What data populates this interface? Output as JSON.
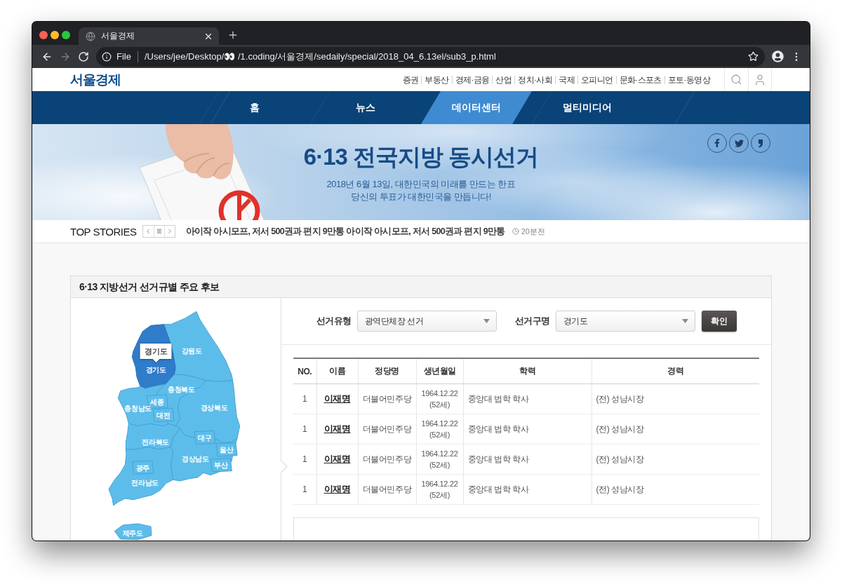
{
  "browser": {
    "tab_title": "서울경제",
    "nav_buttons": [
      {
        "kind": "back",
        "disabled": false
      },
      {
        "kind": "forward",
        "disabled": true
      },
      {
        "kind": "reload",
        "disabled": false
      }
    ],
    "address": {
      "scheme": "File",
      "url": "/Users/jee/Desktop/👀 /1.coding/서울경제/sedaily/special/2018_04_6.13el/sub3_p.html"
    }
  },
  "header": {
    "logo": "서울경제",
    "sections": [
      "증권",
      "부동산",
      "경제·금융",
      "산업",
      "정치·사회",
      "국제",
      "오피니언",
      "문화·스포츠",
      "포토·동영상"
    ]
  },
  "nav": [
    {
      "label": "홈",
      "selected": false
    },
    {
      "label": "뉴스",
      "selected": false
    },
    {
      "label": "데이터센터",
      "selected": true
    },
    {
      "label": "멀티미디어",
      "selected": false
    }
  ],
  "banner": {
    "title": "6·13 전국지방 동시선거",
    "subtitle": [
      "2018년 6월 13일, 대한민국의 미래를 만드는 한표",
      "당신의 투표가 대한민국을 만듭니다!"
    ]
  },
  "top_stories": {
    "heading": "TOP STORIES",
    "headline": "아이작 아시모프, 저서 500권과 편지 9만통 아이작 아시모프, 저서 500권과 편지 9만통",
    "time": "20분전"
  },
  "panel": {
    "title": "6·13 지방선거 선거규별 주요 후보",
    "map": {
      "tooltip": "경기도",
      "regions": [
        {
          "label": "강원도",
          "selected": false
        },
        {
          "label": "경기도",
          "selected": true
        },
        {
          "label": "충청북도",
          "selected": false
        },
        {
          "label": "세종",
          "selected": false
        },
        {
          "label": "충청남도",
          "selected": false
        },
        {
          "label": "대전",
          "selected": false
        },
        {
          "label": "경상북도",
          "selected": false
        },
        {
          "label": "대구",
          "selected": false
        },
        {
          "label": "전라북도",
          "selected": false
        },
        {
          "label": "울산",
          "selected": false
        },
        {
          "label": "경상남도",
          "selected": false
        },
        {
          "label": "부산",
          "selected": false
        },
        {
          "label": "광주",
          "selected": false
        },
        {
          "label": "전라남도",
          "selected": false
        },
        {
          "label": "제주도",
          "selected": false
        }
      ]
    },
    "filters": [
      {
        "label": "선거유형",
        "value": "광역단체장 선거"
      },
      {
        "label": "선거구명",
        "value": "경기도"
      }
    ],
    "confirm_button": "확인",
    "table": {
      "columns": [
        "NO.",
        "이름",
        "정당명",
        "생년월일",
        "학력",
        "경력"
      ],
      "rows": [
        {
          "no": "1",
          "name": "이재명",
          "party": "더불어민주당",
          "birth": "1964.12.22 (52세)",
          "education": "중앙대 법학 학사",
          "career": "(전) 성남시장"
        },
        {
          "no": "1",
          "name": "이재명",
          "party": "더불어민주당",
          "birth": "1964.12.22 (52세)",
          "education": "중앙대 법학 학사",
          "career": "(전) 성남시장"
        },
        {
          "no": "1",
          "name": "이재명",
          "party": "더불어민주당",
          "birth": "1964.12.22 (52세)",
          "education": "중앙대 법학 학사",
          "career": "(전) 성남시장"
        },
        {
          "no": "1",
          "name": "이재명",
          "party": "더불어민주당",
          "birth": "1964.12.22 (52세)",
          "education": "중앙대 법학 학사",
          "career": "(전) 성남시장"
        }
      ]
    }
  }
}
